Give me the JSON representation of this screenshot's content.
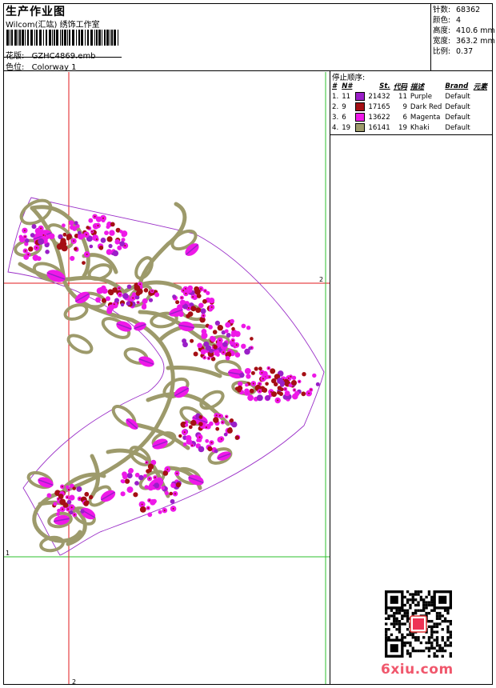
{
  "header": {
    "title": "生产作业图",
    "subtitle": "Wilcom(汇竑) 绣饰工作室",
    "design_label": "花版:",
    "design_value": "GZHC4869.emb",
    "colorway_label": "色位:",
    "colorway_value": "Colorway 1"
  },
  "info": {
    "stitches_label": "针数:",
    "stitches_value": "68362",
    "colors_label": "颜色:",
    "colors_value": "4",
    "height_label": "高度:",
    "height_value": "410.6 mm",
    "width_label": "宽度:",
    "width_value": "363.2 mm",
    "scale_label": "比例:",
    "scale_value": "0.37"
  },
  "stop_sequence": {
    "title": "停止顺序:",
    "headers": [
      "#",
      "N#",
      "St.",
      "代码",
      "描述",
      "Brand",
      "元素"
    ],
    "rows": [
      {
        "num": "1.",
        "n": "11",
        "color": "#9a1fc8",
        "st": "21432",
        "code": "11",
        "desc": "Purple",
        "brand": "Default"
      },
      {
        "num": "2.",
        "n": "9",
        "color": "#a50f14",
        "st": "17165",
        "code": "9",
        "desc": "Dark Red",
        "brand": "Default"
      },
      {
        "num": "3.",
        "n": "6",
        "color": "#ee19e8",
        "st": "13622",
        "code": "6",
        "desc": "Magenta",
        "brand": "Default"
      },
      {
        "num": "4.",
        "n": "19",
        "color": "#9d9a6b",
        "st": "16141",
        "code": "19",
        "desc": "Khaki",
        "brand": "Default"
      }
    ]
  },
  "guides": {
    "h_red_label": "2",
    "h_green_label": "1",
    "v_red_label": "2"
  },
  "colors": {
    "guide_red": "#e0191e",
    "guide_green": "#2ec12e",
    "outline_purple": "#9b30c8",
    "khaki": "#9d9a6b",
    "magenta": "#ee19e8",
    "dark_red": "#a50f14",
    "purple": "#9a1fc8"
  },
  "watermark": {
    "text": "6xiu.com"
  }
}
